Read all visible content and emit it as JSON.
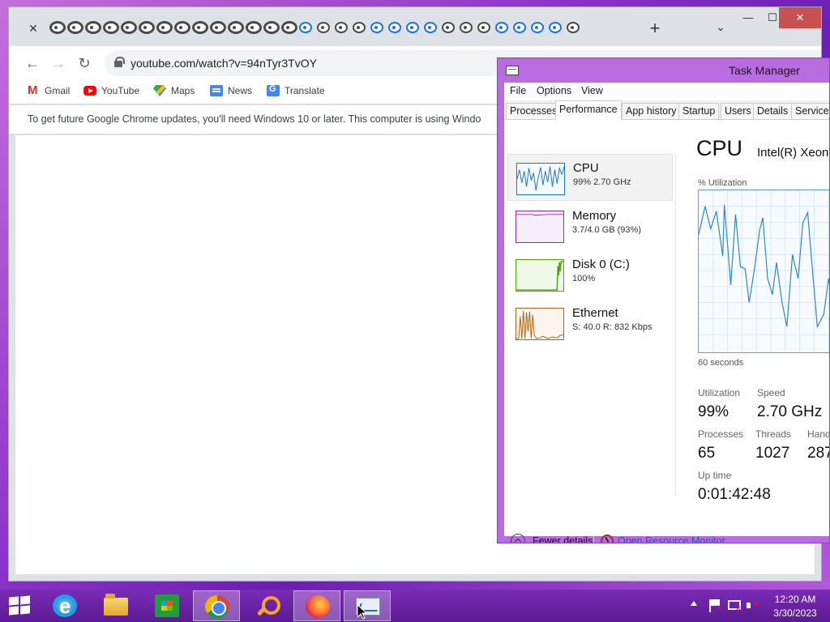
{
  "chrome": {
    "url": "youtube.com/watch?v=94nTyr3TvOY",
    "tab_count_icons": 33,
    "infobar_text": "To get future Google Chrome updates, you'll need Windows 10 or later. This computer is using Windo",
    "bookmarks": [
      {
        "label": "Gmail",
        "icon": "gmail-icon"
      },
      {
        "label": "YouTube",
        "icon": "youtube-icon"
      },
      {
        "label": "Maps",
        "icon": "maps-icon"
      },
      {
        "label": "News",
        "icon": "news-icon"
      },
      {
        "label": "Translate",
        "icon": "translate-icon"
      }
    ],
    "controls": {
      "close_tab": "✕",
      "new_tab": "+",
      "tab_search": "⌄",
      "minimize": "—",
      "maximize": "☐",
      "close": "✕",
      "back": "←",
      "forward": "→",
      "reload": "↻"
    }
  },
  "taskmanager": {
    "title": "Task Manager",
    "menu": [
      "File",
      "Options",
      "View"
    ],
    "tabs": [
      "Processes",
      "Performance",
      "App history",
      "Startup",
      "Users",
      "Details",
      "Services"
    ],
    "active_tab": "Performance",
    "resources": [
      {
        "name": "CPU",
        "detail": "99% 2.70 GHz",
        "color": "#1a73c8",
        "active": true
      },
      {
        "name": "Memory",
        "detail": "3.7/4.0 GB (93%)",
        "color": "#8b2fa8"
      },
      {
        "name": "Disk 0 (C:)",
        "detail": "100%",
        "color": "#4da800"
      },
      {
        "name": "Ethernet",
        "detail": "S: 40.0 R: 832 Kbps",
        "color": "#a8651a"
      }
    ],
    "cpu": {
      "heading": "CPU",
      "model": "Intel(R) Xeon(",
      "util_label": "% Utilization",
      "window_label": "60 seconds",
      "stats": {
        "utilization_label": "Utilization",
        "utilization": "99%",
        "speed_label": "Speed",
        "speed": "2.70 GHz",
        "processes_label": "Processes",
        "processes": "65",
        "threads_label": "Threads",
        "threads": "1027",
        "handles_label": "Hand",
        "handles": "287",
        "uptime_label": "Up time",
        "uptime": "0:01:42:48"
      }
    },
    "footer": {
      "fewer_details": "Fewer details",
      "open_resource_monitor": "Open Resource Monitor"
    }
  },
  "taskbar": {
    "apps": [
      "internet-explorer",
      "file-explorer",
      "store",
      "chrome",
      "search",
      "firefox",
      "task-manager"
    ],
    "active_app": "task-manager",
    "clock_time": "12:20 AM",
    "clock_date": "3/30/2023"
  }
}
